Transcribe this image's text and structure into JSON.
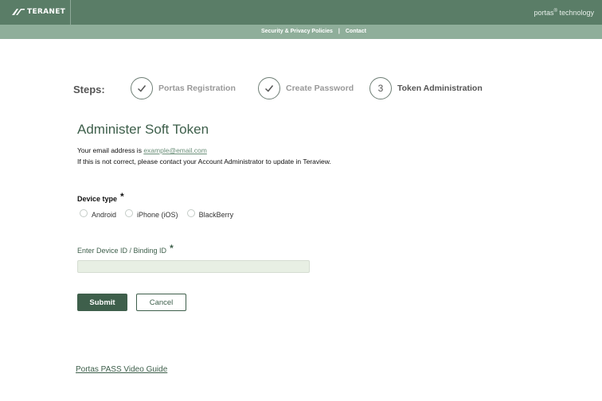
{
  "header": {
    "logo_text": "TERANET",
    "tagline_main": "portas",
    "tagline_mark": "®",
    "tagline_rest": " technology"
  },
  "subnav": {
    "security_label": "Security & Privacy Policies",
    "separator": "|",
    "contact_label": "Contact"
  },
  "steps": {
    "label": "Steps:",
    "items": [
      {
        "label": "Portas Registration",
        "status": "complete"
      },
      {
        "label": "Create Password",
        "status": "complete"
      },
      {
        "number": "3",
        "label": "Token Administration",
        "status": "active"
      }
    ]
  },
  "main": {
    "heading": "Administer Soft Token",
    "email_prefix": "Your email address is ",
    "email": "example@email.com",
    "email_notice": "If this is not correct, please contact your Account Administrator to update in Teraview."
  },
  "form": {
    "device_type_label": "Device type",
    "required_marker": "*",
    "device_options": [
      "Android",
      "iPhone (iOS)",
      "BlackBerry"
    ],
    "device_id_label": "Enter Device ID / Binding ID",
    "device_id_value": "",
    "submit_label": "Submit",
    "cancel_label": "Cancel"
  },
  "footer": {
    "guide_link": "Portas PASS Video Guide"
  },
  "colors": {
    "header_bg": "#5a7d67",
    "subbar_bg": "#8fae9a",
    "accent": "#3e5f4b",
    "input_bg": "#e8efe4"
  }
}
